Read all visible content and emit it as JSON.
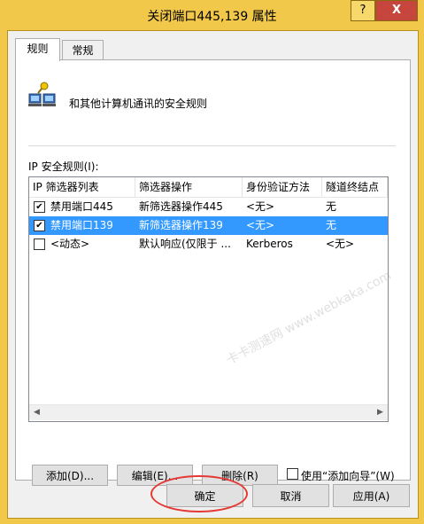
{
  "window": {
    "title": "关闭端口445,139 属性",
    "help_label": "?",
    "close_label": "X"
  },
  "tabs": [
    {
      "label": "规则"
    },
    {
      "label": "常规"
    }
  ],
  "description": "和其他计算机通讯的安全规则",
  "rules": {
    "label": "IP 安全规则(I):",
    "columns": [
      "IP 筛选器列表",
      "筛选器操作",
      "身份验证方法",
      "隧道终结点"
    ],
    "rows": [
      {
        "checked": true,
        "filter": "禁用端口445",
        "action": "新筛选器操作445",
        "auth": "<无>",
        "tunnel": "无"
      },
      {
        "checked": true,
        "filter": "禁用端口139",
        "action": "新筛选器操作139",
        "auth": "<无>",
        "tunnel": "无"
      },
      {
        "checked": false,
        "filter": "<动态>",
        "action": "默认响应(仅限于 ...",
        "auth": "Kerberos",
        "tunnel": "<无>"
      }
    ]
  },
  "buttons": {
    "add": "添加(D)...",
    "edit": "编辑(E)...",
    "remove": "删除(R)",
    "wizard": "使用“添加向导”(W)",
    "ok": "确定",
    "cancel": "取消",
    "apply": "应用(A)"
  },
  "watermark": "卡卡测速网 www.webkaka.com"
}
